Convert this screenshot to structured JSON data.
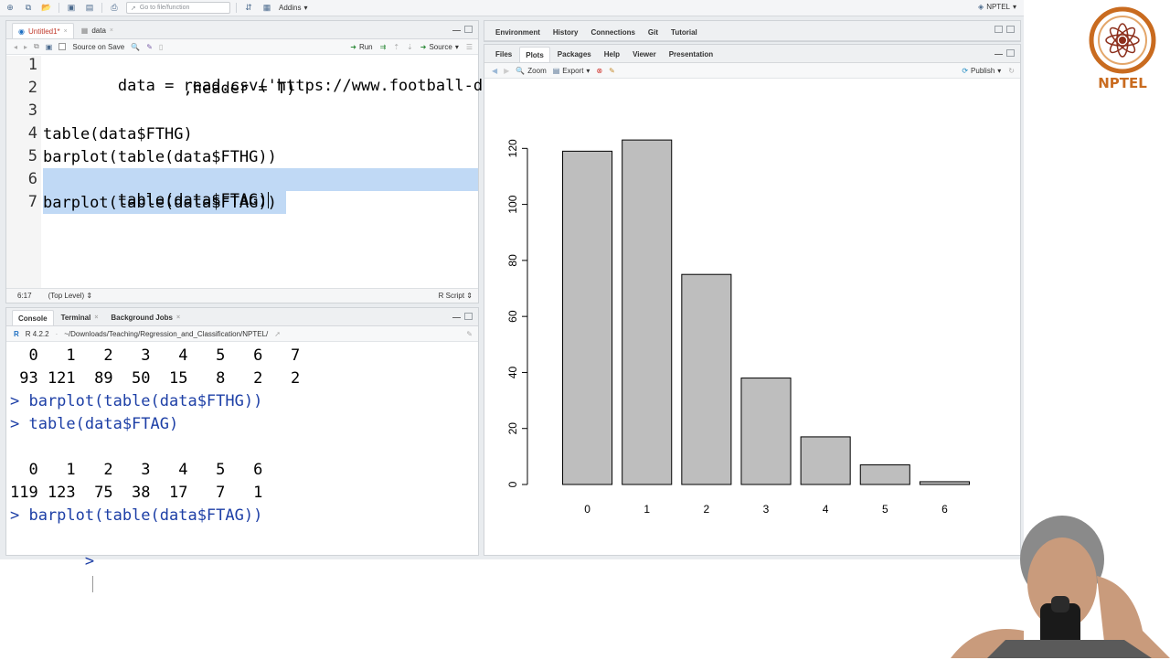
{
  "toolbar": {
    "goto_placeholder": "Go to file/function",
    "addins_label": "Addins",
    "project_label": "NPTEL"
  },
  "editor": {
    "tabs": [
      {
        "label": "Untitled1*"
      },
      {
        "label": "data"
      }
    ],
    "source_on_save_label": "Source on Save",
    "run_label": "Run",
    "source_label": "Source",
    "line_numbers": [
      "1",
      "2",
      "3",
      "4",
      "5",
      "6",
      "7"
    ],
    "status": {
      "position": "6:17",
      "scope": "(Top Level)",
      "file_type": "R Script"
    }
  },
  "console": {
    "tabs": [
      {
        "label": "Console"
      },
      {
        "label": "Terminal"
      },
      {
        "label": "Background Jobs"
      }
    ],
    "r_version": "R 4.2.2",
    "path": "~/Downloads/Teaching/Regression_and_Classification/NPTEL/",
    "prompt_char": ">"
  },
  "env_tabs": [
    {
      "label": "Environment"
    },
    {
      "label": "History"
    },
    {
      "label": "Connections"
    },
    {
      "label": "Git"
    },
    {
      "label": "Tutorial"
    }
  ],
  "plot_tabs": [
    {
      "label": "Files"
    },
    {
      "label": "Plots"
    },
    {
      "label": "Packages"
    },
    {
      "label": "Help"
    },
    {
      "label": "Viewer"
    },
    {
      "label": "Presentation"
    }
  ],
  "plot_toolbar": {
    "zoom_label": "Zoom",
    "export_label": "Export",
    "publish_label": "Publish"
  },
  "code_lines": [
    "data = read.csv('https://www.football-data.co",
    "               ,header = T)",
    "",
    "table(data$FTHG)",
    "barplot(table(data$FTHG))",
    "table(data$FTAG)",
    "barplot(table(data$FTAG))"
  ],
  "console_lines": [
    "  0   1   2   3   4   5   6   7",
    " 93 121  89  50  15   8   2   2",
    "> barplot(table(data$FTHG))",
    "> table(data$FTAG)",
    "",
    "  0   1   2   3   4   5   6",
    "119 123  75  38  17   7   1",
    "> barplot(table(data$FTAG))",
    ">"
  ],
  "chart_data": {
    "type": "bar",
    "categories": [
      "0",
      "1",
      "2",
      "3",
      "4",
      "5",
      "6"
    ],
    "values": [
      119,
      123,
      75,
      38,
      17,
      7,
      1
    ],
    "title": "",
    "xlabel": "",
    "ylabel": "",
    "ylim": [
      0,
      125
    ],
    "yticks": [
      0,
      20,
      40,
      60,
      80,
      100,
      120
    ],
    "bar_color": "#bebebe",
    "grid": false
  },
  "logo": {
    "text": "NPTEL",
    "color": "#c96b1f"
  },
  "colors": {
    "selection": "#c0d9f5",
    "prompt": "#1d3fa6",
    "string": "#1a7a1a"
  }
}
